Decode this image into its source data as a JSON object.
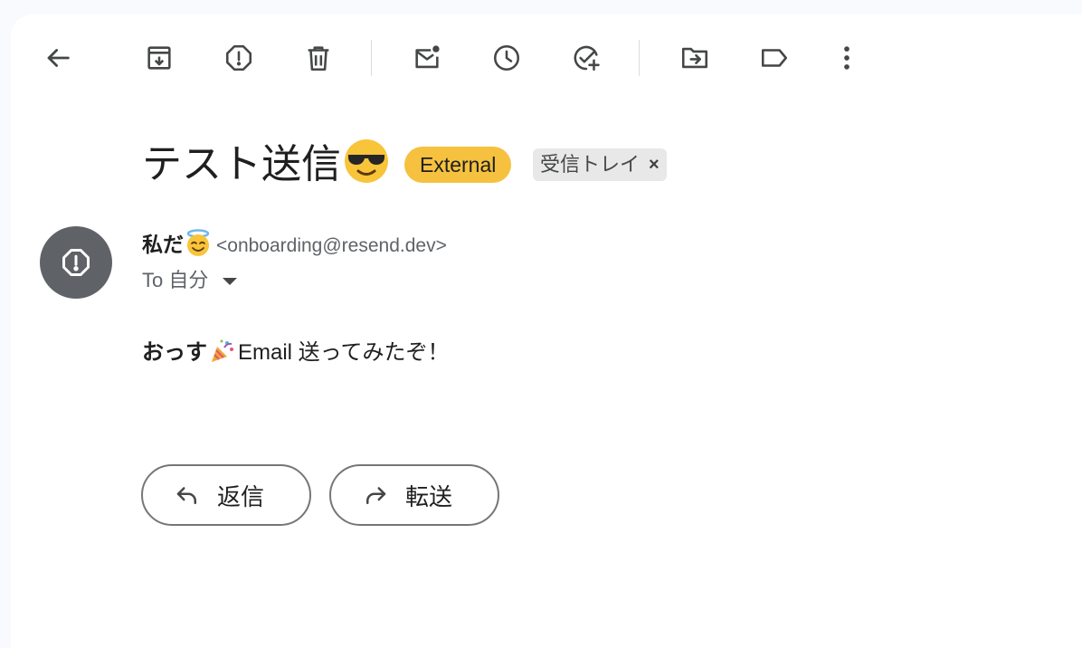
{
  "toolbar": {
    "items": [
      {
        "name": "back",
        "icon": "arrow-left-icon"
      },
      {
        "name": "archive",
        "icon": "archive-icon"
      },
      {
        "name": "report-spam",
        "icon": "report-icon"
      },
      {
        "name": "delete",
        "icon": "trash-icon"
      },
      {
        "name": "mark-unread",
        "icon": "mark-unread-icon"
      },
      {
        "name": "snooze",
        "icon": "clock-icon"
      },
      {
        "name": "add-task",
        "icon": "add-task-icon"
      },
      {
        "name": "move-to",
        "icon": "move-to-folder-icon"
      },
      {
        "name": "labels",
        "icon": "label-icon"
      },
      {
        "name": "more",
        "icon": "more-vert-icon"
      }
    ]
  },
  "message": {
    "subject": "テスト送信",
    "subject_emoji": "smiling-face-with-sunglasses",
    "external_label": "External",
    "inbox_label": "受信トレイ",
    "inbox_remove": "×",
    "sender_name": "私だ",
    "sender_emoji": "smiling-face-with-halo",
    "sender_email": "<onboarding@resend.dev>",
    "to_text": "To 自分",
    "body_bold": "おっす",
    "body_emoji": "party-popper",
    "body_rest": "Email 送ってみたぞ！"
  },
  "actions": {
    "reply_label": "返信",
    "forward_label": "転送"
  },
  "colors": {
    "external_chip": "#f5c13f",
    "inbox_chip": "#e8e8e8",
    "avatar": "#5f6368",
    "icon": "#444746"
  }
}
